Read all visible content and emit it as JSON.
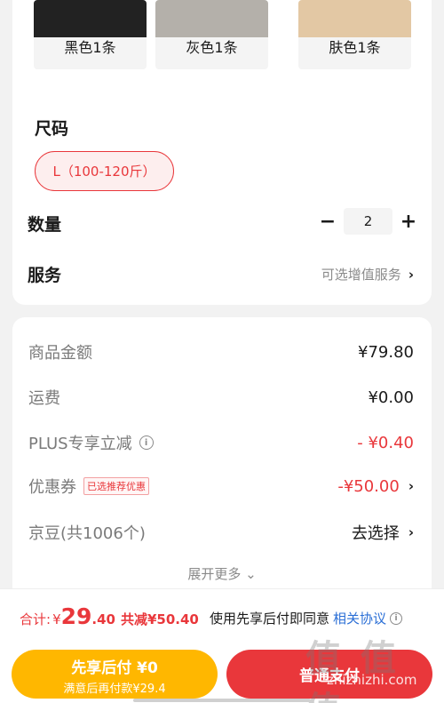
{
  "variants": [
    {
      "label": "黑色1条",
      "color": "#222222"
    },
    {
      "label": "灰色1条",
      "color": "#b4b0aa"
    },
    {
      "label": "肤色1条",
      "color": "#e3c8a4"
    }
  ],
  "size": {
    "title": "尺码",
    "selected": "L（100-120斤）"
  },
  "quantity": {
    "label": "数量",
    "value": "2",
    "minus": "−",
    "plus": "+"
  },
  "service": {
    "label": "服务",
    "value": "可选增值服务"
  },
  "price": {
    "goods_label": "商品金额",
    "goods_value": "¥79.80",
    "shipping_label": "运费",
    "shipping_value": "¥0.00",
    "plus_label": "PLUS专享立减",
    "plus_value": "- ¥0.40",
    "coupon_label": "优惠券",
    "coupon_tag": "已选推荐优惠",
    "coupon_value": "-¥50.00",
    "jd_label": "京豆(共1006个)",
    "jd_value": "去选择",
    "expand": "展开更多"
  },
  "bottom": {
    "total_label": "合计:",
    "total_yen": "¥",
    "total_int": "29",
    "total_dec": ".40",
    "total_save": "共减¥50.40",
    "agree_text": "使用先享后付即同意",
    "agree_link": "相关协议",
    "later_main": "先享后付 ¥0",
    "later_sub": "满意后再付款¥29.4",
    "pay": "普通支付"
  },
  "watermark": {
    "big": "值 值 值",
    "small": "zhizhizhi.com"
  },
  "colors": {
    "accent": "#e9373b",
    "yellow": "#ffb700",
    "link": "#2b6fd6"
  }
}
